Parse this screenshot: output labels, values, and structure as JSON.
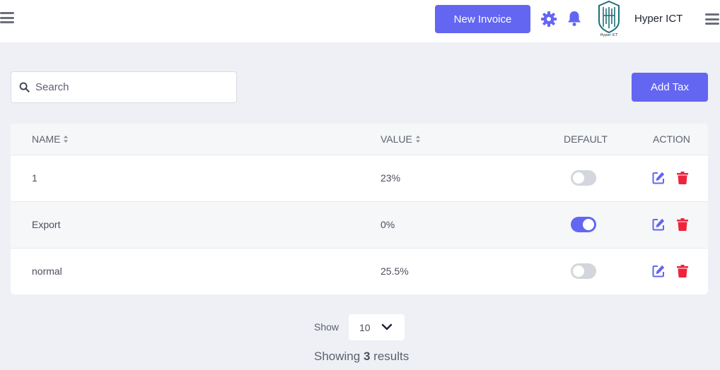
{
  "header": {
    "new_invoice_label": "New Invoice",
    "org_name": "Hyper ICT",
    "logo_text": "Hyper ICT",
    "icons": [
      "menu-icon",
      "gear-icon",
      "bell-icon",
      "menu-icon"
    ]
  },
  "toolbar": {
    "search_placeholder": "Search",
    "add_tax_label": "Add Tax"
  },
  "table": {
    "columns": {
      "name": "NAME",
      "value": "VALUE",
      "default": "DEFAULT",
      "action": "ACTION"
    },
    "rows": [
      {
        "name": "1",
        "value": "23%",
        "default": false
      },
      {
        "name": "Export",
        "value": "0%",
        "default": true
      },
      {
        "name": "normal",
        "value": "25.5%",
        "default": false
      }
    ]
  },
  "pagination": {
    "show_label": "Show",
    "page_size": "10",
    "results_prefix": "Showing",
    "results_count": "3",
    "results_suffix": "results"
  },
  "colors": {
    "accent": "#6366f1",
    "danger": "#ef233c",
    "background": "#eef0f5"
  }
}
